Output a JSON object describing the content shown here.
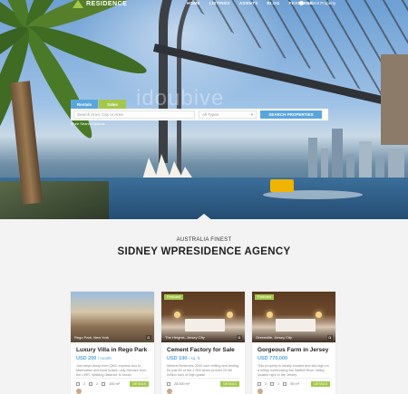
{
  "nav": {
    "logo_text": "RESIDENCE",
    "menu": [
      "HOME",
      "LISTINGS",
      "AGENTS",
      "BLOG",
      "FEATURES"
    ],
    "submit_label": "Submit Property"
  },
  "hero": {
    "watermark": "idoubive"
  },
  "search": {
    "tab_rentals": "Rentals",
    "tab_sales": "Sales",
    "location_placeholder": "Search Area, City or Area",
    "type_placeholder": "All Types",
    "button_label": "SEARCH PROPERTIES",
    "more_options": "More Search Options"
  },
  "intro": {
    "eyebrow": "AUSTRALIA FINEST",
    "headline": "SIDNEY WPRESIDENCE AGENCY"
  },
  "cards": [
    {
      "badge": "",
      "location": "Rego Park, New York",
      "title": "Luxury Villa in Rego Park",
      "price": "USD 200",
      "price_unit": "/ month",
      "description": "Just steps away from QMC express bus to Manhattan and local buses; only minutes from the LIRR. Walking distance to bread",
      "beds": "2",
      "baths": "2",
      "size": "150 m²",
      "details": "DETAILS"
    },
    {
      "badge": "Featured",
      "location": "The Heights, Jersey City",
      "title": "Cement Factory for Sale",
      "price": "USD 100",
      "price_unit": "/ sq. ft.",
      "description": "Mineral Reserves 2000 core drilling and testing for just 60 of the 1,000 acres proved 20 Mil million tons of high grade",
      "beds": "",
      "baths": "",
      "size": "28,000 m²",
      "details": "DETAILS"
    },
    {
      "badge": "Featured",
      "location": "Greenville, Jersey City",
      "title": "Gorgeous Farm in Jersey",
      "price": "USD 770,000",
      "price_unit": "",
      "description": "This property is ideally located and sits high on a hilltop overlooking the Wallkill River Valley, located right in the Jersey",
      "beds": "2",
      "baths": "2",
      "size": "55 m²",
      "details": "DETAILS"
    }
  ],
  "colors": {
    "accent_blue": "#59a6dd",
    "accent_green": "#a3c84b",
    "page_bg": "#f3f3f3"
  }
}
